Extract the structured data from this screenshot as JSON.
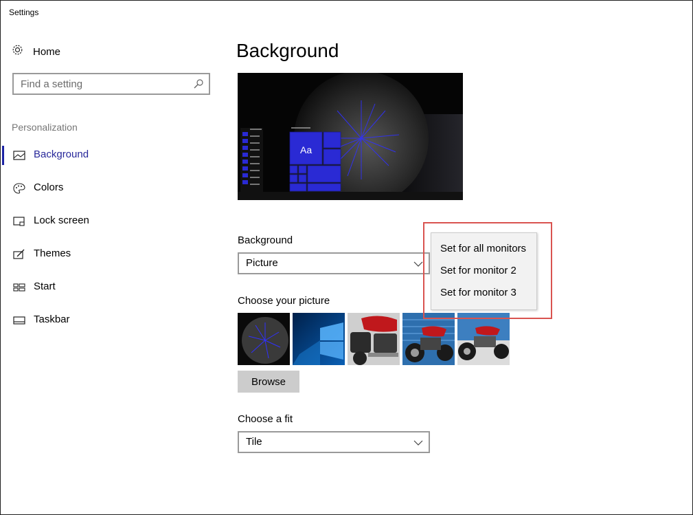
{
  "window": {
    "title": "Settings"
  },
  "sidebar": {
    "home_label": "Home",
    "search_placeholder": "Find a setting",
    "section_label": "Personalization",
    "items": [
      {
        "label": "Background",
        "icon": "picture-icon",
        "active": true
      },
      {
        "label": "Colors",
        "icon": "palette-icon",
        "active": false
      },
      {
        "label": "Lock screen",
        "icon": "lock-screen-icon",
        "active": false
      },
      {
        "label": "Themes",
        "icon": "themes-icon",
        "active": false
      },
      {
        "label": "Start",
        "icon": "start-icon",
        "active": false
      },
      {
        "label": "Taskbar",
        "icon": "taskbar-icon",
        "active": false
      }
    ]
  },
  "main": {
    "title": "Background",
    "preview_sample_text": "Aa",
    "background_label": "Background",
    "background_value": "Picture",
    "choose_picture_label": "Choose your picture",
    "browse_label": "Browse",
    "fit_label": "Choose a fit",
    "fit_value": "Tile"
  },
  "context_menu": {
    "items": [
      "Set for all monitors",
      "Set for monitor 2",
      "Set for monitor 3"
    ]
  },
  "colors": {
    "accent": "#1c23a3",
    "tile_blue": "#2a2ad4",
    "highlight_border": "#d9534f"
  }
}
